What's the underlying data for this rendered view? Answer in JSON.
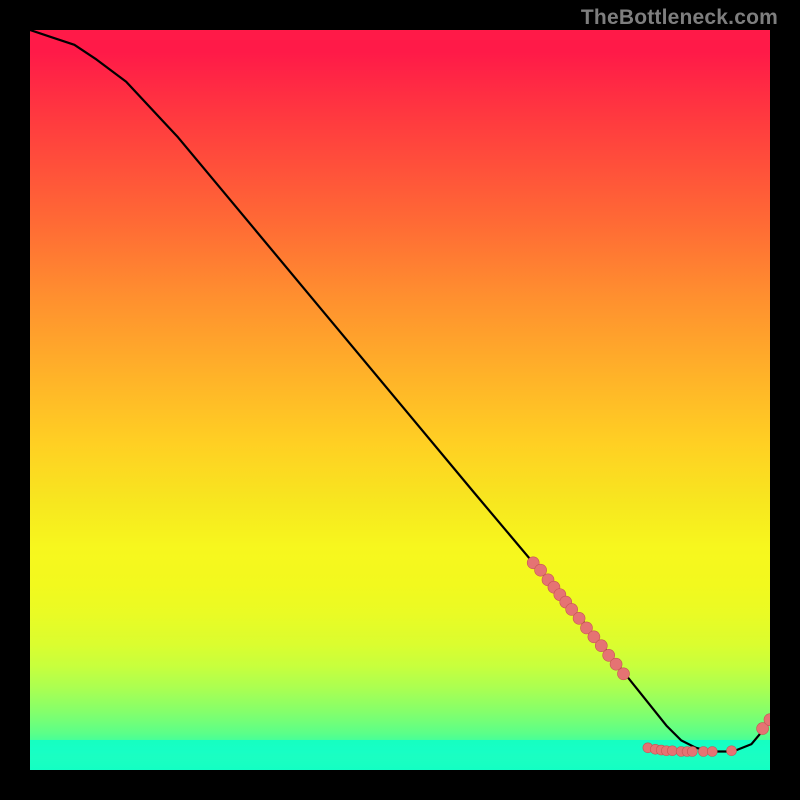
{
  "watermark": "TheBottleneck.com",
  "colors": {
    "line": "#000000",
    "marker_fill": "#e57373",
    "marker_stroke": "#c75454"
  },
  "chart_data": {
    "type": "line",
    "title": "",
    "xlabel": "",
    "ylabel": "",
    "xlim": [
      0,
      100
    ],
    "ylim": [
      0,
      100
    ],
    "grid": false,
    "series": [
      {
        "name": "curve",
        "x": [
          0,
          3,
          6,
          9,
          13,
          20,
          30,
          40,
          50,
          60,
          68,
          71,
          74,
          76,
          78,
          80,
          82,
          84,
          86,
          88,
          90,
          92,
          95,
          97.5,
          100
        ],
        "y": [
          100,
          99,
          98,
          96,
          93,
          85.5,
          73.5,
          61.5,
          49.5,
          37.5,
          28,
          24.5,
          21,
          18.5,
          16,
          13.5,
          11,
          8.5,
          6,
          4,
          3,
          2.5,
          2.5,
          3.5,
          6.5
        ]
      }
    ],
    "markers": [
      {
        "x": 68.0,
        "y": 28.0,
        "r": 5
      },
      {
        "x": 69.0,
        "y": 27.0,
        "r": 5
      },
      {
        "x": 70.0,
        "y": 25.7,
        "r": 5
      },
      {
        "x": 70.8,
        "y": 24.7,
        "r": 5
      },
      {
        "x": 71.6,
        "y": 23.7,
        "r": 5
      },
      {
        "x": 72.4,
        "y": 22.7,
        "r": 5
      },
      {
        "x": 73.2,
        "y": 21.7,
        "r": 5
      },
      {
        "x": 74.2,
        "y": 20.5,
        "r": 5
      },
      {
        "x": 75.2,
        "y": 19.2,
        "r": 5
      },
      {
        "x": 76.2,
        "y": 18.0,
        "r": 5
      },
      {
        "x": 77.2,
        "y": 16.8,
        "r": 5
      },
      {
        "x": 78.2,
        "y": 15.5,
        "r": 5
      },
      {
        "x": 79.2,
        "y": 14.3,
        "r": 5
      },
      {
        "x": 80.2,
        "y": 13.0,
        "r": 5
      },
      {
        "x": 83.5,
        "y": 3.0,
        "r": 4
      },
      {
        "x": 84.5,
        "y": 2.8,
        "r": 4
      },
      {
        "x": 85.3,
        "y": 2.7,
        "r": 4
      },
      {
        "x": 86.0,
        "y": 2.6,
        "r": 4
      },
      {
        "x": 86.8,
        "y": 2.6,
        "r": 4
      },
      {
        "x": 88.0,
        "y": 2.5,
        "r": 4
      },
      {
        "x": 88.8,
        "y": 2.5,
        "r": 4
      },
      {
        "x": 89.5,
        "y": 2.5,
        "r": 4
      },
      {
        "x": 91.0,
        "y": 2.5,
        "r": 4
      },
      {
        "x": 92.2,
        "y": 2.5,
        "r": 4
      },
      {
        "x": 94.8,
        "y": 2.6,
        "r": 4
      },
      {
        "x": 99.0,
        "y": 5.6,
        "r": 5
      },
      {
        "x": 100.0,
        "y": 6.8,
        "r": 5
      }
    ]
  }
}
